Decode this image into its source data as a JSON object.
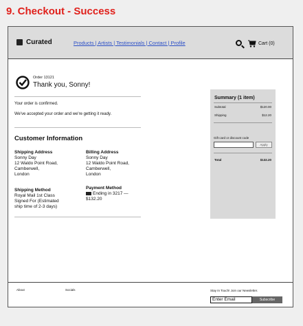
{
  "page_heading": "9. Checkout - Success",
  "header": {
    "logo": "Curated",
    "nav": "Products | Artists | Testimonials | Contact | Profile",
    "search_icon": "search-icon",
    "cart_icon": "cart-icon",
    "cart_label": "Cart (0)"
  },
  "order": {
    "number": "Order 13121",
    "thanks": "Thank you, Sonny!",
    "confirmed": "Your order is confirmed.",
    "accepted": "We've accepted your order and we're getting it ready."
  },
  "customer": {
    "title": "Customer Information",
    "shipping_address": {
      "label": "Shipping Address",
      "lines": [
        "Sonny Day",
        "12 Waldo Point Road,",
        "Camberwell,",
        "London"
      ]
    },
    "billing_address": {
      "label": "Billing Address",
      "lines": [
        "Sonny Day",
        "12 Waldo Point Road,",
        "Camberwell,",
        "London"
      ]
    },
    "shipping_method": {
      "label": "Shipping Method",
      "lines": [
        "Royal Mail 1st Class",
        "Signed For (Estimated",
        "ship time of 2-3 days)"
      ]
    },
    "payment_method": {
      "label": "Payment Method",
      "card": "Ending in 3217 —",
      "amount": "$132.20"
    }
  },
  "summary": {
    "title": "Summary (1 item)",
    "subtotal_label": "Subtotal",
    "subtotal_value": "$120.00",
    "shipping_label": "Shipping",
    "shipping_value": "$12.20",
    "gift_label": "Gift card or discount code",
    "gift_placeholder": "",
    "apply": "Apply",
    "total_label": "Total",
    "total_value": "$132.20"
  },
  "footer": {
    "about": "About",
    "socials": "Socials",
    "newsletter": "Stay In Touch! Join our Newsletter.",
    "email_placeholder": "Enter Email",
    "subscribe": "Subscribe"
  }
}
